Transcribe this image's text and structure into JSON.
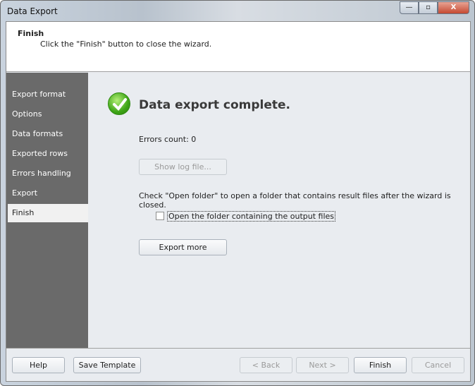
{
  "window": {
    "title": "Data Export",
    "min": "—",
    "max": "▫",
    "close": "X"
  },
  "header": {
    "title": "Finish",
    "subtitle": "Click the \"Finish\" button to close the wizard."
  },
  "sidebar": {
    "items": [
      {
        "label": "Export format"
      },
      {
        "label": "Options"
      },
      {
        "label": "Data formats"
      },
      {
        "label": "Exported rows"
      },
      {
        "label": "Errors handling"
      },
      {
        "label": "Export"
      },
      {
        "label": "Finish",
        "active": true
      }
    ]
  },
  "main": {
    "heading": "Data export complete.",
    "errors": "Errors count: 0",
    "show_log": "Show log file...",
    "hint": "Check \"Open folder\" to open a folder that contains result files after the wizard is closed.",
    "open_folder_label": "Open the folder containing the output files",
    "open_folder_checked": false,
    "export_more": "Export more"
  },
  "footer": {
    "help": "Help",
    "save_template": "Save Template",
    "back": "< Back",
    "next": "Next >",
    "finish": "Finish",
    "cancel": "Cancel"
  }
}
